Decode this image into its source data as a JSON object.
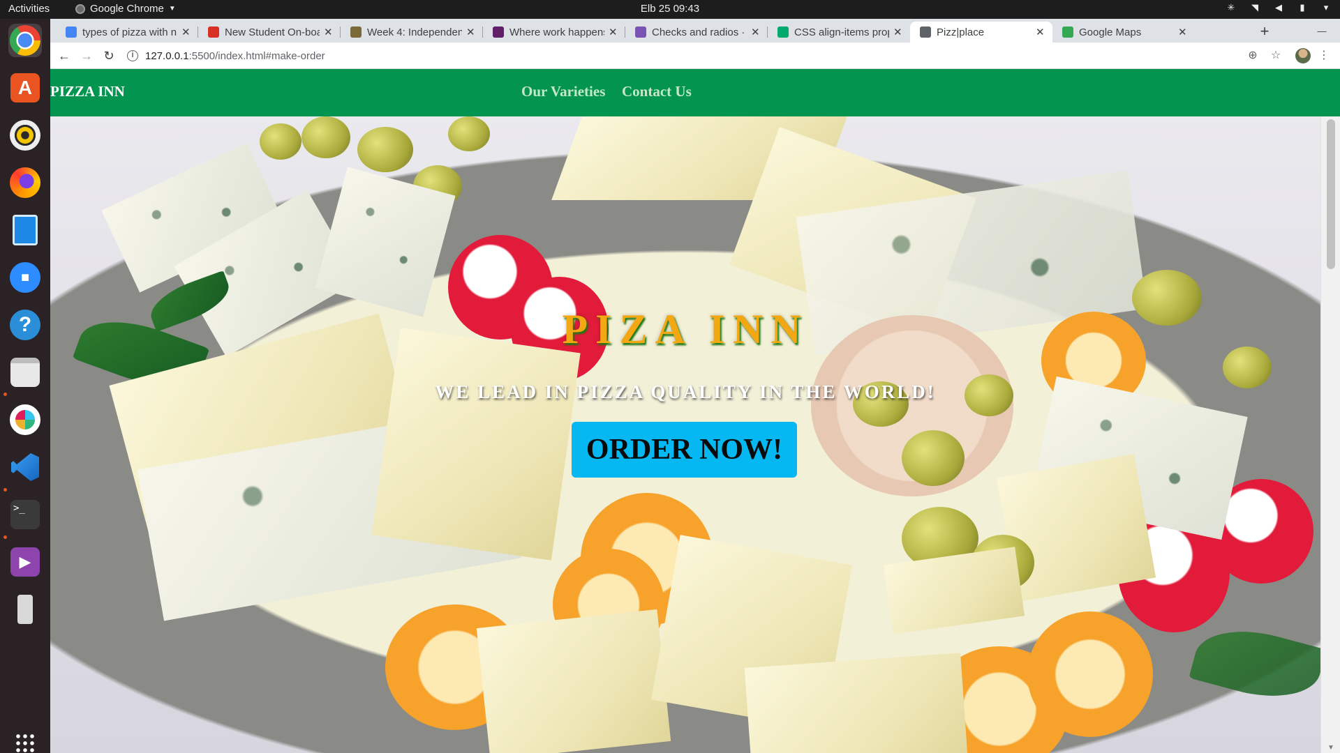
{
  "system": {
    "activities_label": "Activities",
    "app_name": "Google Chrome",
    "clock": "Elb 25  09:43"
  },
  "tabs": [
    {
      "title": "types of pizza with n",
      "favicon": "google-icon",
      "color": "#4285f4"
    },
    {
      "title": "New Student On-boa",
      "favicon": "gmail-icon",
      "color": "#d93025"
    },
    {
      "title": "Week 4: Independen",
      "favicon": "leaf-icon",
      "color": "#7a6a3a"
    },
    {
      "title": "Where work happens",
      "favicon": "slack-icon",
      "color": "#611f69"
    },
    {
      "title": "Checks and radios · E",
      "favicon": "bootstrap-icon",
      "color": "#7952b3"
    },
    {
      "title": "CSS align-items prop",
      "favicon": "w3schools-icon",
      "color": "#04aa6d"
    },
    {
      "title": "Pizz|place",
      "favicon": "globe-icon",
      "color": "#5f6368"
    },
    {
      "title": "Google Maps",
      "favicon": "maps-icon",
      "color": "#34a853"
    }
  ],
  "address_bar": {
    "host": "127.0.0.1",
    "rest": ":5500/index.html#make-order"
  },
  "site": {
    "brand": "PIZZA INN",
    "nav": [
      "Our Varieties",
      "Contact Us"
    ],
    "hero_title": "PIZA INN",
    "hero_tagline": "WE LEAD IN PIZZA QUALITY IN THE WORLD!",
    "cta_label": "ORDER NOW!"
  },
  "colors": {
    "nav_background": "#03954f",
    "title_color": "#f3a712",
    "button_background": "#05b8f1"
  },
  "dock": [
    "chrome-icon",
    "ubuntu-software-icon",
    "rhythmbox-icon",
    "firefox-icon",
    "writer-icon",
    "zoom-icon",
    "help-icon",
    "files-icon",
    "slack-icon",
    "vscode-icon",
    "terminal-icon",
    "video-icon",
    "usb-drive-icon",
    "show-apps-icon"
  ]
}
